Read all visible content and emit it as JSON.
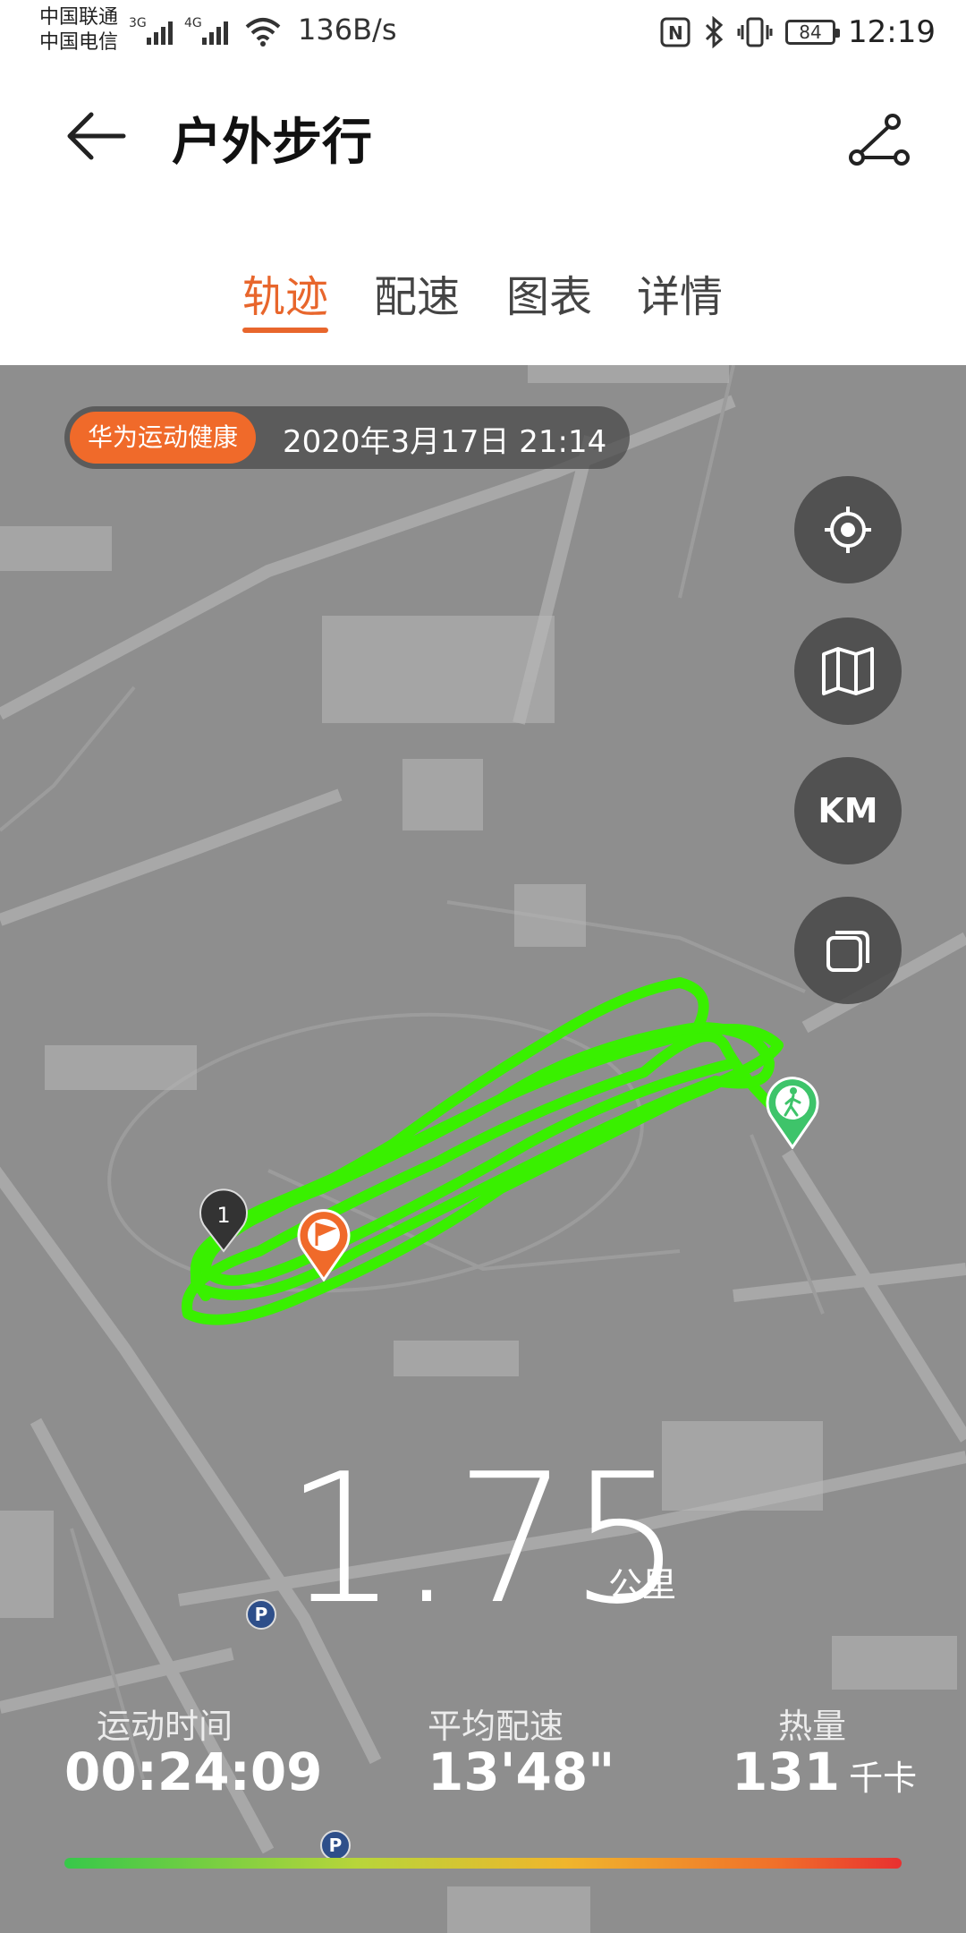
{
  "status_bar": {
    "carrier_1": "中国联通",
    "carrier_2": "中国电信",
    "net_1": "3G",
    "net_2": "4G",
    "net_speed": "136B/s",
    "nfc_label": "N",
    "battery": "84",
    "time": "12:19"
  },
  "header": {
    "title": "户外步行"
  },
  "tabs": [
    {
      "label": "轨迹",
      "active": true
    },
    {
      "label": "配速",
      "active": false
    },
    {
      "label": "图表",
      "active": false
    },
    {
      "label": "详情",
      "active": false
    }
  ],
  "map": {
    "app_badge": "华为运动健康",
    "date": "2020年3月17日 21:14",
    "controls": {
      "km_label": "KM"
    },
    "markers": {
      "lap_number": "1",
      "parking_label": "P"
    },
    "track_color": "#39f000"
  },
  "summary": {
    "distance_value": "1.75",
    "distance_unit": "公里",
    "stats": [
      {
        "label": "运动时间",
        "value": "00:24:09",
        "unit": ""
      },
      {
        "label": "平均配速",
        "value": "13'48\"",
        "unit": ""
      },
      {
        "label": "热量",
        "value": "131",
        "unit": "千卡"
      }
    ]
  },
  "colors": {
    "accent": "#e8662c",
    "map_bg": "#8e8e8e"
  }
}
